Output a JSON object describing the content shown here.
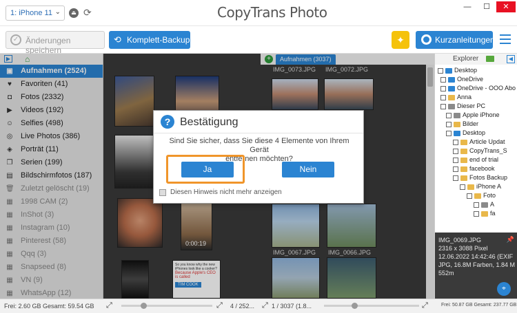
{
  "app": {
    "device": "1: iPhone 11",
    "logo_text": "CopyTrans Photo",
    "window_controls": [
      "—",
      "☐",
      "✕"
    ]
  },
  "toolbar": {
    "save_label": "Änderungen speichern",
    "backup_label": "Komplett-Backup",
    "guide_label": "Kurzanleitungen"
  },
  "sidebar": {
    "items": [
      {
        "label": "Aufnahmen (2524)",
        "icon": "camera-roll-icon",
        "glyph": "▣"
      },
      {
        "label": "Favoriten (41)",
        "icon": "heart-icon",
        "glyph": "♥"
      },
      {
        "label": "Fotos (2332)",
        "icon": "camera-icon",
        "glyph": "◘"
      },
      {
        "label": "Videos (192)",
        "icon": "video-icon",
        "glyph": "▶"
      },
      {
        "label": "Selfies (498)",
        "icon": "selfie-icon",
        "glyph": "☺"
      },
      {
        "label": "Live Photos (386)",
        "icon": "live-photo-icon",
        "glyph": "◎"
      },
      {
        "label": "Porträt (11)",
        "icon": "portrait-icon",
        "glyph": "◈"
      },
      {
        "label": "Serien (199)",
        "icon": "burst-icon",
        "glyph": "❐"
      },
      {
        "label": "Bildschirmfotos (187)",
        "icon": "screenshot-icon",
        "glyph": "▤"
      },
      {
        "label": "Zuletzt gelöscht (19)",
        "icon": "trash-icon",
        "glyph": "🗑"
      },
      {
        "label": "1998 CAM (2)",
        "icon": "album-icon",
        "glyph": "▦"
      },
      {
        "label": "InShot (3)",
        "icon": "album-icon",
        "glyph": "▦"
      },
      {
        "label": "Instagram (10)",
        "icon": "album-icon",
        "glyph": "▦"
      },
      {
        "label": "Pinterest (58)",
        "icon": "album-icon",
        "glyph": "▦"
      },
      {
        "label": "Qqq (3)",
        "icon": "album-icon",
        "glyph": "▦"
      },
      {
        "label": "Snapseed (8)",
        "icon": "album-icon",
        "glyph": "▦"
      },
      {
        "label": "VN (9)",
        "icon": "album-icon",
        "glyph": "▦"
      },
      {
        "label": "WhatsApp (12)",
        "icon": "album-icon",
        "glyph": "▦"
      }
    ]
  },
  "left_grid": {
    "video_duration": "0:00:19",
    "thumb_text_1": "So you know why the new iPhones look like a cooker?",
    "thumb_text_2": "Because Apple's CEO is called",
    "thumb_text_3": "TIM COOK"
  },
  "right_grid": {
    "tab_label": "Aufnahmen (3037)",
    "labels": [
      "IMG_0073.JPG",
      "IMG_0072.JPG",
      "IMG_0067.JPG",
      "IMG_0066.JPG"
    ]
  },
  "explorer": {
    "title": "Explorer",
    "tree": [
      "Desktop",
      "OneDrive",
      "OneDrive - OOO Abo",
      "Anna",
      "Dieser PC",
      "Apple iPhone",
      "Bilder",
      "Desktop",
      "Article Updat",
      "CopyTrans_S",
      "end of trial",
      "facebook",
      "Fotos Backup",
      "iPhone A",
      "Foto",
      "A",
      "fa"
    ]
  },
  "info": {
    "filename": "IMG_0069.JPG",
    "size": "2316 x 3088 Pixel",
    "date": "12.06.2022 14:42:46 (EXIF",
    "format": "JPG, 16.8M Farben, 1.84 M",
    "distance": "552m"
  },
  "status": {
    "left": "Frei: 2.60 GB Gesamt: 59.54 GB",
    "left_count": "4 / 252...",
    "right_count": "1 / 3037 (1.8...",
    "right": "Frei: 50.87 GB Gesamt: 237.77 GB"
  },
  "dialog": {
    "title": "Bestätigung",
    "message_line1": "Sind Sie sicher, dass Sie diese 4 Elemente von Ihrem Gerät",
    "message_line2": "entfernen möchten?",
    "yes_label": "Ja",
    "no_label": "Nein",
    "checkbox_label": "Diesen Hinweis nicht mehr anzeigen"
  },
  "colors": {
    "accent": "#2b84d2",
    "highlight": "#f0952a",
    "bulb": "#f5c20b"
  }
}
